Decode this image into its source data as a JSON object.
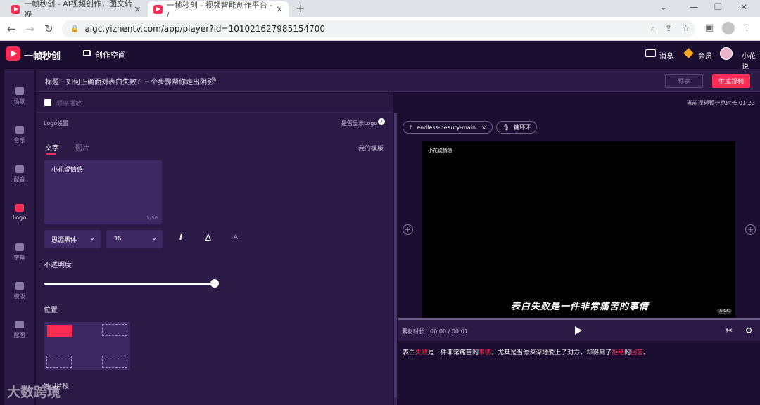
{
  "browser": {
    "tabs": [
      {
        "title": "一帧秒创 - AI视频创作，图文转视",
        "close": "×"
      },
      {
        "title": "一帧秒创 - 视频智能创作平台 - /",
        "close": "×"
      }
    ],
    "new_tab": "+",
    "url": "aigc.yizhentv.com/app/player?id=101021627985154700"
  },
  "header": {
    "app_name": "一帧秒创",
    "create_space": "创作空间",
    "messages": "消息",
    "vip": "会员",
    "username": "小花说"
  },
  "sidebar": {
    "items": [
      {
        "label": "场景",
        "icon": "scene-icon"
      },
      {
        "label": "音乐",
        "icon": "music-icon"
      },
      {
        "label": "配音",
        "icon": "voice-icon"
      },
      {
        "label": "Logo",
        "icon": "logo-icon",
        "active": true
      },
      {
        "label": "字幕",
        "icon": "subtitle-icon"
      },
      {
        "label": "模版",
        "icon": "template-icon"
      },
      {
        "label": "配图",
        "icon": "image-icon"
      }
    ]
  },
  "titlebar": {
    "title": "标题：如何正确面对表白失败？三个步骤帮你走出阴影",
    "preview_btn": "预览",
    "generate_btn": "生成视频"
  },
  "left_panel": {
    "seq_play": "顺序播放",
    "logo_settings": "Logo设置",
    "show_logo": "是否显示Logo",
    "tab_text": "文字",
    "tab_image": "图片",
    "my_templates": "我的模版",
    "logo_text": "小花说情感",
    "char_count": "5/30",
    "font": "思源黑体",
    "font_size": "36",
    "opacity_label": "不透明度",
    "opacity_value": 1.0,
    "position_label": "位置",
    "cut_label": "导出片段"
  },
  "right_panel": {
    "duration_label": "当前视频预计总时长 01:23",
    "chip_music": "endless-beauty-main",
    "chip_voice": "糖环环",
    "video_logo": "小花说情感",
    "video_subtitle": "表白失败是一件非常痛苦的事情",
    "video_badge": "AIGC",
    "material_time": "素材时长：00:00  /  00:07",
    "script_parts": [
      {
        "t": "表白",
        "hl": false
      },
      {
        "t": "失败",
        "hl": true
      },
      {
        "t": "是一件非常痛苦的",
        "hl": false
      },
      {
        "t": "事情",
        "hl": true
      },
      {
        "t": "，尤其是当你深深地爱上了对方，却得到了",
        "hl": false
      },
      {
        "t": "拒绝",
        "hl": true
      },
      {
        "t": "的",
        "hl": false
      },
      {
        "t": "回答",
        "hl": true
      },
      {
        "t": "。",
        "hl": false
      }
    ]
  },
  "watermark": "大数跨境",
  "colors": {
    "accent": "#ff2d55",
    "bg": "#1c0e30",
    "panel": "#2c1a47"
  }
}
